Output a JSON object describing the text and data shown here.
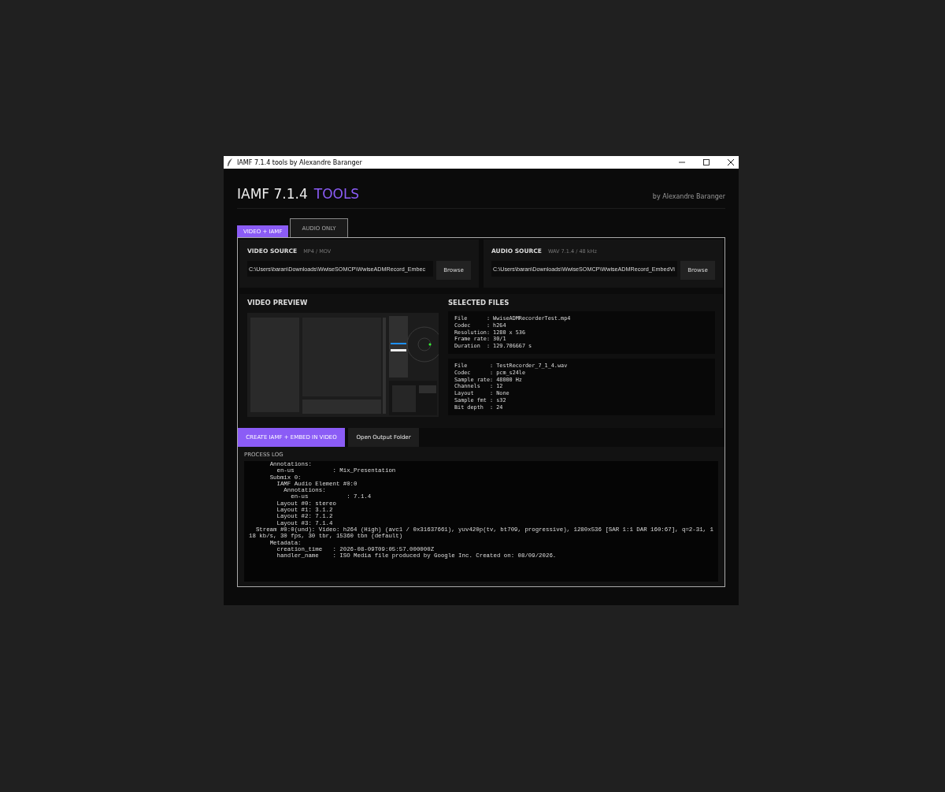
{
  "window": {
    "title": "IAMF 7.1.4 tools by Alexandre Baranger"
  },
  "header": {
    "title": "IAMF 7.1.4",
    "accent": "TOOLS",
    "byline": "by Alexandre Baranger"
  },
  "tabs": [
    {
      "label": "VIDEO + IAMF",
      "selected": true
    },
    {
      "label": "AUDIO ONLY",
      "selected": false
    }
  ],
  "sources": [
    {
      "title": "VIDEO SOURCE",
      "hint": "MP4 / MOV",
      "value": "C:\\Users\\baran\\Downloads\\WwiseSOMCP\\WwiseADMRecord_Embec",
      "button": "Browse"
    },
    {
      "title": "AUDIO SOURCE",
      "hint": "WAV 7.1.4 / 48 kHz",
      "value": "C:\\Users\\baran\\Downloads\\WwiseSOMCP\\WwiseADMRecord_EmbedVi",
      "button": "Browse"
    }
  ],
  "preview": {
    "title": "VIDEO PREVIEW",
    "kind": "picture"
  },
  "selected_files": {
    "title": "SELECTED FILES",
    "groups": [
      [
        "File      : WwiseADMRecorderTest.mp4",
        "Codec     : h264",
        "Resolution: 1280 x 536",
        "Frame rate: 30/1",
        "Duration  : 129.706667 s"
      ],
      [
        "File       : TestRecorder_7_1_4.wav",
        "Codec      : pcm_s24le",
        "Sample rate: 48000 Hz",
        "Channels   : 12",
        "Layout     : None",
        "Sample fmt : s32",
        "Bit depth  : 24"
      ]
    ]
  },
  "actions": [
    {
      "label": "CREATE IAMF + EMBED IN VIDEO",
      "kind": "primary"
    },
    {
      "label": "Open Output Folder",
      "kind": "secondary"
    }
  ],
  "log": {
    "title": "PROCESS LOG",
    "lines": [
      "      Annotations:",
      "        en-us           : Mix_Presentation",
      "      Submix 0:",
      "        IAMF Audio Element #0:0",
      "          Annotations:",
      "            en-us           : 7.1.4",
      "        Layout #0: stereo",
      "        Layout #1: 3.1.2",
      "        Layout #2: 7.1.2",
      "        Layout #3: 7.1.4",
      "  Stream #0:0(und): Video: h264 (High) (avc1 / 0x31637661), yuv420p(tv, bt709, progressive), 1280x536 [SAR 1:1 DAR 160:67], q=2-31, 118 kb/s, 30 fps, 30 tbr, 15360 tbn (default)",
      "      Metadata:",
      "        creation_time   : 2026-08-09T09:05:57.000000Z",
      "        handler_name    : ISO Media file produced by Google Inc. Created on: 08/09/2026."
    ]
  }
}
